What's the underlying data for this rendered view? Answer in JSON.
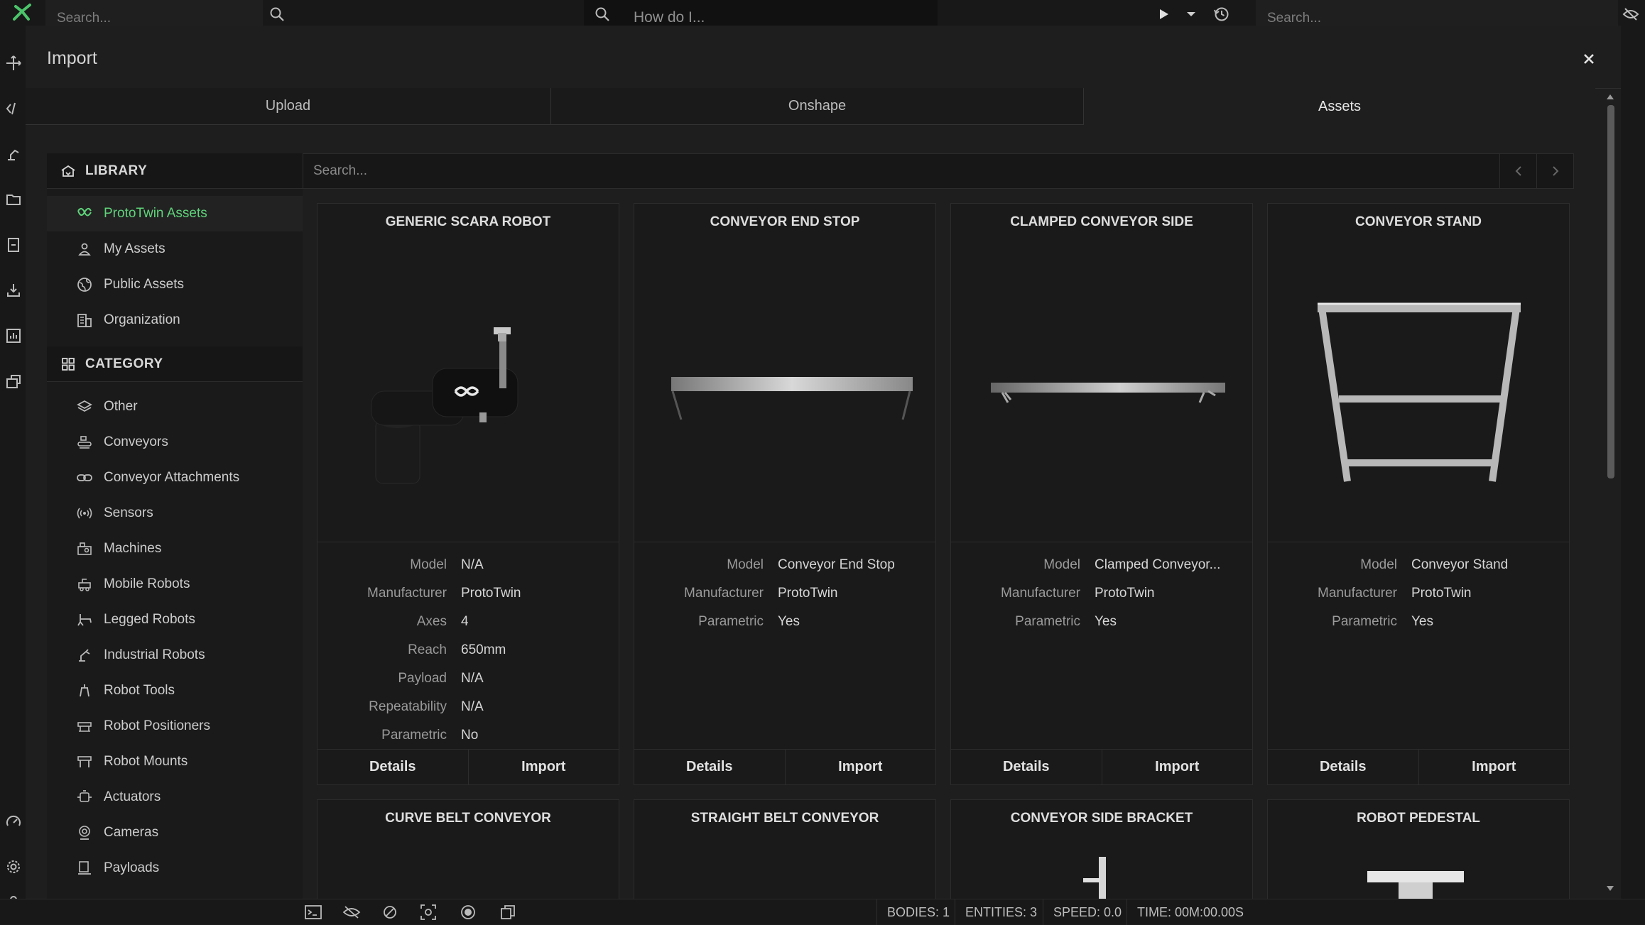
{
  "topbar": {
    "search_left_placeholder": "Search...",
    "howdo_placeholder": "How do I...",
    "search_right_placeholder": "Search..."
  },
  "dialog": {
    "title": "Import",
    "tabs": [
      {
        "label": "Upload"
      },
      {
        "label": "Onshape"
      },
      {
        "label": "Assets",
        "active": true
      }
    ]
  },
  "sidebar": {
    "library_header": "LIBRARY",
    "library_items": [
      {
        "label": "ProtoTwin Assets",
        "icon": "prototwin-icon",
        "active": true
      },
      {
        "label": "My Assets",
        "icon": "user-icon"
      },
      {
        "label": "Public Assets",
        "icon": "globe-icon"
      },
      {
        "label": "Organization",
        "icon": "building-icon"
      }
    ],
    "category_header": "CATEGORY",
    "category_items": [
      {
        "label": "Other",
        "icon": "layers-icon"
      },
      {
        "label": "Conveyors",
        "icon": "conveyor-icon"
      },
      {
        "label": "Conveyor Attachments",
        "icon": "link-icon"
      },
      {
        "label": "Sensors",
        "icon": "sensor-icon"
      },
      {
        "label": "Machines",
        "icon": "machine-icon"
      },
      {
        "label": "Mobile Robots",
        "icon": "mobile-robot-icon"
      },
      {
        "label": "Legged Robots",
        "icon": "legged-robot-icon"
      },
      {
        "label": "Industrial Robots",
        "icon": "industrial-robot-icon"
      },
      {
        "label": "Robot Tools",
        "icon": "gripper-icon"
      },
      {
        "label": "Robot Positioners",
        "icon": "positioner-icon"
      },
      {
        "label": "Robot Mounts",
        "icon": "mount-icon"
      },
      {
        "label": "Actuators",
        "icon": "actuator-icon"
      },
      {
        "label": "Cameras",
        "icon": "camera-icon"
      },
      {
        "label": "Payloads",
        "icon": "payload-icon"
      }
    ]
  },
  "content": {
    "search_placeholder": "Search..."
  },
  "cards": [
    {
      "title": "GENERIC SCARA ROBOT",
      "image": "scara-robot",
      "specs": [
        [
          "Model",
          "N/A"
        ],
        [
          "Manufacturer",
          "ProtoTwin"
        ],
        [
          "Axes",
          "4"
        ],
        [
          "Reach",
          "650mm"
        ],
        [
          "Payload",
          "N/A"
        ],
        [
          "Repeatability",
          "N/A"
        ],
        [
          "Parametric",
          "No"
        ]
      ]
    },
    {
      "title": "CONVEYOR END STOP",
      "image": "conveyor-end-stop",
      "specs": [
        [
          "Model",
          "Conveyor End Stop"
        ],
        [
          "Manufacturer",
          "ProtoTwin"
        ],
        [
          "Parametric",
          "Yes"
        ]
      ]
    },
    {
      "title": "CLAMPED CONVEYOR SIDE",
      "image": "clamped-conveyor-side",
      "specs": [
        [
          "Model",
          "Clamped Conveyor..."
        ],
        [
          "Manufacturer",
          "ProtoTwin"
        ],
        [
          "Parametric",
          "Yes"
        ]
      ]
    },
    {
      "title": "CONVEYOR STAND",
      "image": "conveyor-stand",
      "specs": [
        [
          "Model",
          "Conveyor Stand"
        ],
        [
          "Manufacturer",
          "ProtoTwin"
        ],
        [
          "Parametric",
          "Yes"
        ]
      ]
    },
    {
      "title": "CURVE BELT CONVEYOR",
      "image": "curve-belt-conveyor"
    },
    {
      "title": "STRAIGHT BELT CONVEYOR",
      "image": "straight-belt-conveyor"
    },
    {
      "title": "CONVEYOR SIDE BRACKET",
      "image": "conveyor-side-bracket"
    },
    {
      "title": "ROBOT PEDESTAL",
      "image": "robot-pedestal"
    }
  ],
  "card_actions": {
    "details": "Details",
    "import": "Import"
  },
  "status": {
    "bodies": "BODIES: 1",
    "entities": "ENTITIES: 3",
    "speed": "SPEED: 0.0",
    "time": "TIME: 00M:00.00S"
  },
  "colors": {
    "accent": "#5fd37a",
    "background": "#1e1e1e"
  }
}
